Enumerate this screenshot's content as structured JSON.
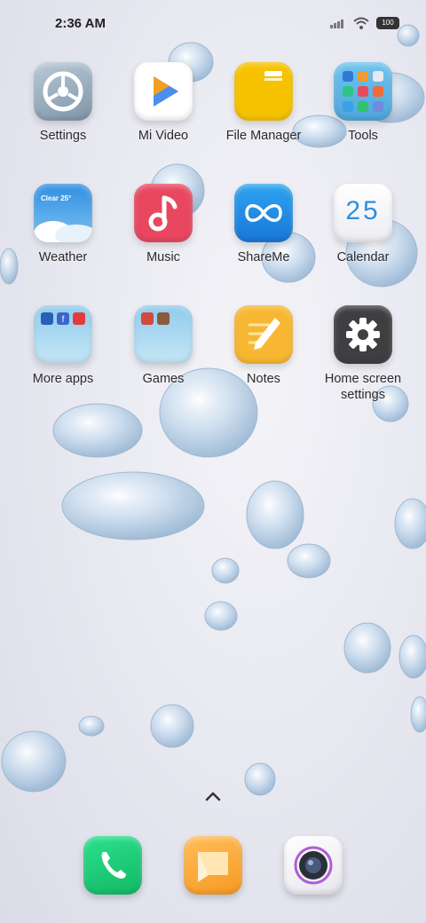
{
  "status_bar": {
    "time": "2:36 AM",
    "battery": "100",
    "icons": [
      "signal-icon",
      "wifi-icon",
      "battery-icon"
    ]
  },
  "apps": [
    {
      "label": "Settings",
      "icon": "gear-icon"
    },
    {
      "label": "Mi Video",
      "icon": "play-icon"
    },
    {
      "label": "File Manager",
      "icon": "folder-icon"
    },
    {
      "label": "Tools",
      "icon": "tools-folder-icon"
    },
    {
      "label": "Weather",
      "icon": "weather-icon",
      "text": "Clear 25°"
    },
    {
      "label": "Music",
      "icon": "music-note-icon"
    },
    {
      "label": "ShareMe",
      "icon": "infinity-icon"
    },
    {
      "label": "Calendar",
      "icon": "calendar-icon",
      "text": "25"
    },
    {
      "label": "More apps",
      "icon": "folder-icon"
    },
    {
      "label": "Games",
      "icon": "folder-icon"
    },
    {
      "label": "Notes",
      "icon": "notes-icon"
    },
    {
      "label": "Home screen settings",
      "icon": "settings-cog-icon"
    }
  ],
  "dock": [
    {
      "name": "phone",
      "icon": "phone-icon"
    },
    {
      "name": "messages",
      "icon": "message-icon"
    },
    {
      "name": "camera",
      "icon": "camera-icon"
    }
  ],
  "colors": {
    "music": "#e8475f",
    "shareme": "#1e8ee8",
    "file_manager": "#f6c200",
    "notes": "#f7b732",
    "phone": "#1fcf7a",
    "messages": "#f7a838"
  }
}
